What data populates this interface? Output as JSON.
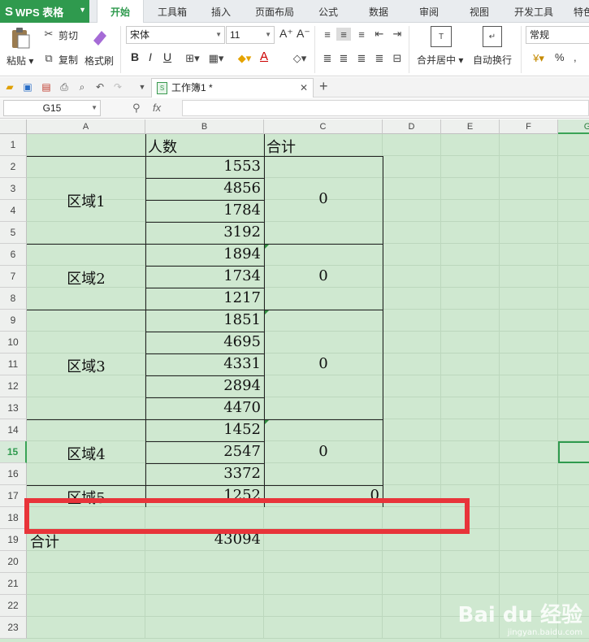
{
  "app": {
    "logo": "WPS 表格",
    "logo_glyph": "S",
    "accent": "#2f9a4e"
  },
  "menu": {
    "tabs": [
      "开始",
      "工具箱",
      "插入",
      "页面布局",
      "公式",
      "数据",
      "审阅",
      "视图",
      "开发工具",
      "特色"
    ],
    "active": "开始"
  },
  "ribbon": {
    "paste": "粘贴",
    "cut": "剪切",
    "copy": "复制",
    "format_painter": "格式刷",
    "font_name": "宋体",
    "font_size": "11",
    "bold": "B",
    "italic": "I",
    "underline": "U",
    "merge_center": "合并居中",
    "wrap_text": "自动换行",
    "number_format": "常规",
    "percent": "%",
    "grow_font": "A⁺",
    "shrink_font": "A⁻",
    "font_color_glyph": "A"
  },
  "document": {
    "tab_title": "工作簿1 *"
  },
  "formula_bar": {
    "name_box": "G15",
    "fx_label": "fx",
    "value": ""
  },
  "sheet": {
    "columns": [
      "A",
      "B",
      "C",
      "D",
      "E",
      "F",
      "G"
    ],
    "rows": [
      "1",
      "2",
      "3",
      "4",
      "5",
      "6",
      "7",
      "8",
      "9",
      "10",
      "11",
      "12",
      "13",
      "14",
      "15",
      "16",
      "17",
      "18",
      "19",
      "20",
      "21",
      "22",
      "23"
    ],
    "active_row": "15",
    "active_col": "G",
    "header_b": "人数",
    "header_c": "合计",
    "regions": [
      {
        "label": "区域1",
        "subtotal": "0"
      },
      {
        "label": "区域2",
        "subtotal": "0"
      },
      {
        "label": "区域3",
        "subtotal": "0"
      },
      {
        "label": "区域4",
        "subtotal": "0"
      },
      {
        "label": "区域5",
        "subtotal": "0"
      }
    ],
    "values": [
      "1553",
      "4856",
      "1784",
      "3192",
      "1894",
      "1734",
      "1217",
      "1851",
      "4695",
      "4331",
      "2894",
      "4470",
      "1452",
      "2547",
      "3372",
      "1252"
    ],
    "total_label": "合计",
    "total_value": "43094"
  },
  "watermark": {
    "text": "Bai du 经验",
    "sub": "jingyan.baidu.com"
  }
}
